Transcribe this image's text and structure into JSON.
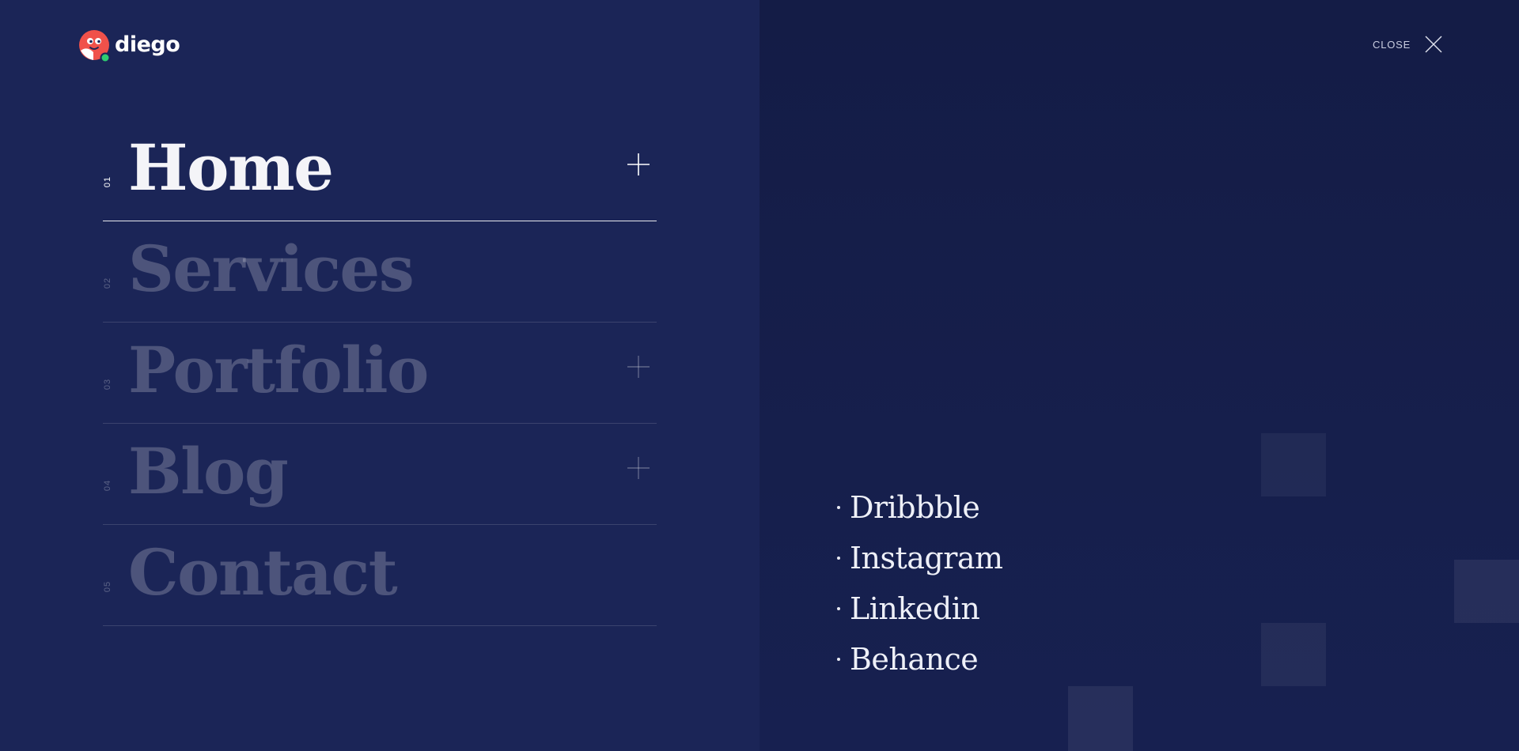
{
  "logo": {
    "text": "diego"
  },
  "header": {
    "close_label": "CLOSE"
  },
  "menu": {
    "items": [
      {
        "number": "01",
        "label": "Home",
        "active": true,
        "has_submenu": true
      },
      {
        "number": "02",
        "label": "Services",
        "active": false,
        "has_submenu": false
      },
      {
        "number": "03",
        "label": "Portfolio",
        "active": false,
        "has_submenu": true
      },
      {
        "number": "04",
        "label": "Blog",
        "active": false,
        "has_submenu": true
      },
      {
        "number": "05",
        "label": "Contact",
        "active": false,
        "has_submenu": false
      }
    ]
  },
  "social": {
    "items": [
      {
        "label": "Dribbble"
      },
      {
        "label": "Instagram"
      },
      {
        "label": "Linkedin"
      },
      {
        "label": "Behance"
      }
    ]
  },
  "colors": {
    "background_left": "#1b2557",
    "background_right": "#141c46",
    "logo_red": "#f0514a",
    "online_green": "#2ecc71"
  },
  "icons": {
    "close": "close-x-icon",
    "expand": "plus-icon",
    "logo": "face-mascot-icon"
  }
}
